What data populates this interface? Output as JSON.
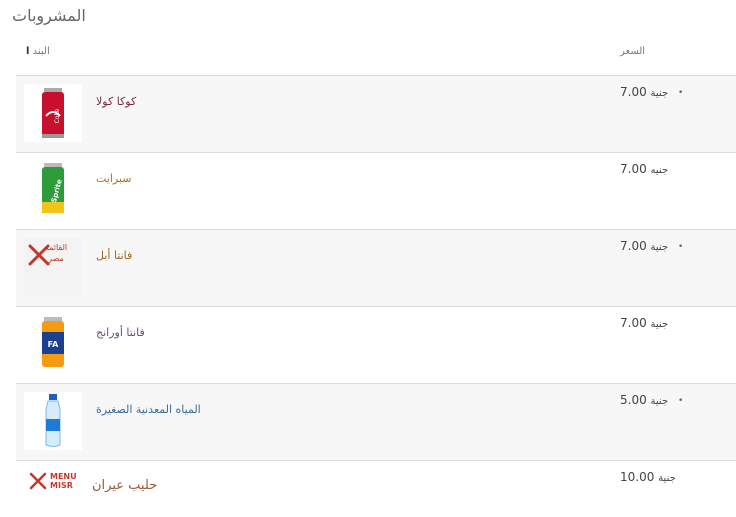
{
  "page": {
    "title": "المشروبات"
  },
  "table": {
    "header_item": "البند",
    "header_item_mark": "ا",
    "header_price": "السعر"
  },
  "colors": {
    "brand_red": "#c0392b"
  },
  "items": [
    {
      "name": "كوكا كولا",
      "price": "7.00",
      "currency": "جنية",
      "image": "coca-cola-can-icon",
      "name_color": "#7a2a4a"
    },
    {
      "name": "سبرايت",
      "price": "7.00",
      "currency": "جنيه",
      "image": "sprite-can-icon",
      "name_color": "#b06a2a"
    },
    {
      "name": "فانتا أبل",
      "price": "7.00",
      "currency": "جنية",
      "image": "menu-misr-placeholder-icon",
      "placeholder_text": "القائمة مصر",
      "name_color": "#9a6a2a"
    },
    {
      "name": "فانتا أورانج",
      "price": "7.00",
      "currency": "جنية",
      "image": "fanta-orange-can-icon",
      "name_color": "#6a4a7a"
    },
    {
      "name": "المياه المعدنية الصغيرة",
      "price": "5.00",
      "currency": "جنية",
      "image": "water-bottle-icon",
      "name_color": "#3a6a9a"
    },
    {
      "name": "حليب عيران",
      "price": "10.00",
      "currency": "جنية",
      "image": "menu-misr-logo-icon",
      "logo_text_1": "MENU",
      "logo_text_2": "MISR",
      "name_color": "#9a5a3a"
    }
  ]
}
